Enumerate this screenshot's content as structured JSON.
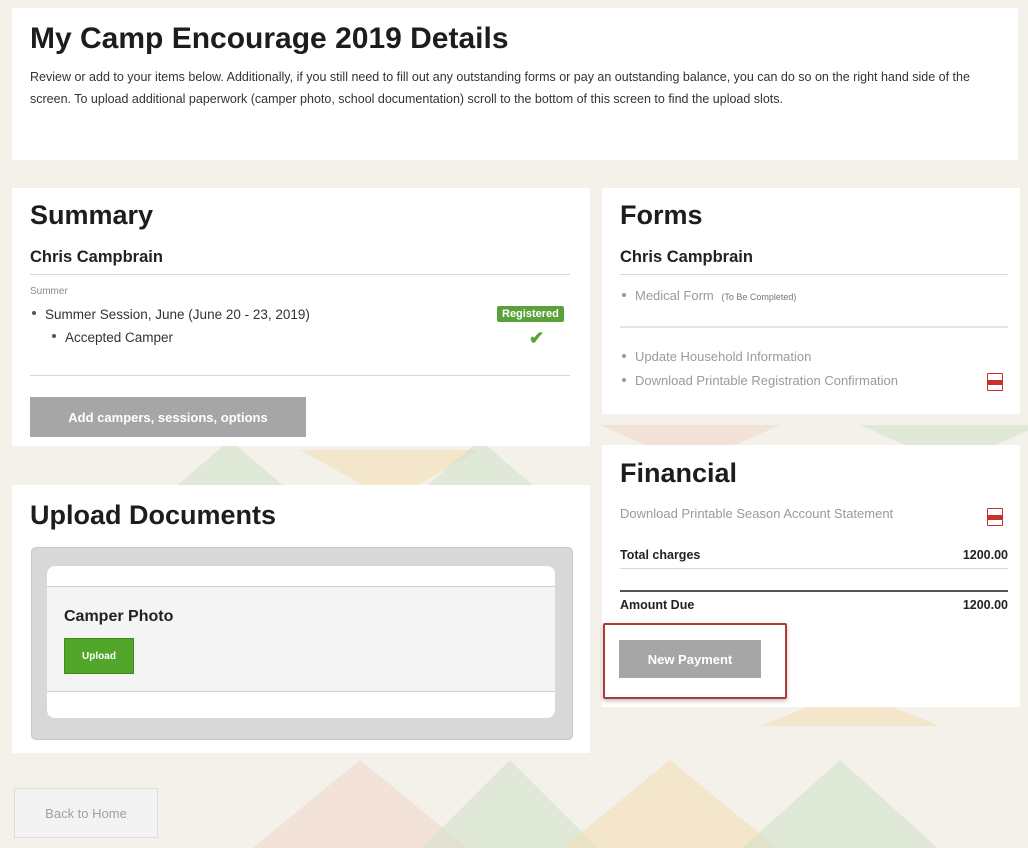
{
  "page": {
    "title": "My Camp Encourage 2019 Details",
    "intro": "Review or add to your items below. Additionally, if you still need to fill out any outstanding forms or pay an outstanding balance, you can do so on the right hand side of the screen. To upload additional paperwork (camper photo, school documentation) scroll to the bottom of this screen to find the upload slots."
  },
  "summary": {
    "title": "Summary",
    "camper_name": "Chris Campbrain",
    "season_label": "Summer",
    "session": "Summer Session, June (June 20 - 23, 2019)",
    "status_badge": "Registered",
    "sub_item": "Accepted Camper",
    "add_button": "Add campers, sessions, options"
  },
  "upload": {
    "title": "Upload Documents",
    "slot_label": "Camper Photo",
    "upload_button": "Upload"
  },
  "forms": {
    "title": "Forms",
    "camper_name": "Chris Campbrain",
    "medical_form": "Medical Form",
    "medical_form_status": "(To Be Completed)",
    "update_household": "Update Household Information",
    "download_confirmation": "Download Printable Registration Confirmation"
  },
  "financial": {
    "title": "Financial",
    "download_statement": "Download Printable Season Account Statement",
    "total_charges_label": "Total charges",
    "total_charges_value": "1200.00",
    "amount_due_label": "Amount Due",
    "amount_due_value": "1200.00",
    "new_payment_button": "New Payment"
  },
  "nav": {
    "back_home": "Back to Home"
  },
  "colors": {
    "accent_green": "#5aa13a",
    "highlight_red": "#b03a3a",
    "button_grey": "#a6a6a6"
  }
}
